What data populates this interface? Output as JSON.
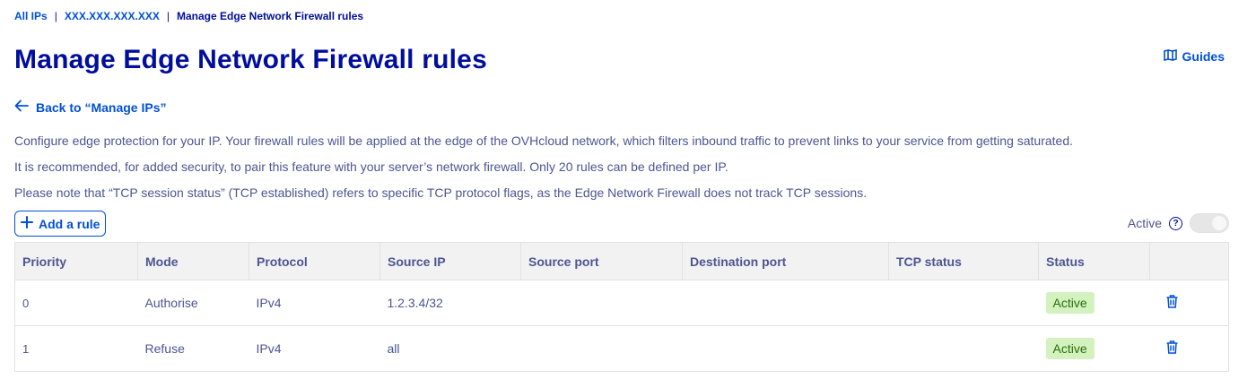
{
  "breadcrumb": {
    "root": "All IPs",
    "ip": "XXX.XXX.XXX.XXX",
    "current": "Manage Edge Network Firewall rules"
  },
  "header": {
    "title": "Manage Edge Network Firewall rules",
    "guides_label": "Guides"
  },
  "back_link": "Back to “Manage IPs”",
  "description": {
    "line1": "Configure edge protection for your IP. Your firewall rules will be applied at the edge of the OVHcloud network, which filters inbound traffic to prevent links to your service from getting saturated.",
    "line2": "It is recommended, for added security, to pair this feature with your server’s network firewall. Only 20 rules can be defined per IP.",
    "line3": "Please note that “TCP session status” (TCP established) refers to specific TCP protocol flags, as the Edge Network Firewall does not track TCP sessions."
  },
  "toolbar": {
    "add_rule_label": "Add a rule",
    "active_label": "Active",
    "help_glyph": "?"
  },
  "table": {
    "columns": [
      "Priority",
      "Mode",
      "Protocol",
      "Source IP",
      "Source port",
      "Destination port",
      "TCP status",
      "Status",
      ""
    ],
    "rows": [
      {
        "priority": "0",
        "mode": "Authorise",
        "protocol": "IPv4",
        "source_ip": "1.2.3.4/32",
        "source_port": "",
        "destination_port": "",
        "tcp_status": "",
        "status": "Active"
      },
      {
        "priority": "1",
        "mode": "Refuse",
        "protocol": "IPv4",
        "source_ip": "all",
        "source_port": "",
        "destination_port": "",
        "tcp_status": "",
        "status": "Active"
      }
    ]
  },
  "icons": {
    "guides": "book-icon",
    "back": "arrow-left-icon",
    "add": "plus-icon",
    "help": "question-circle-icon",
    "delete": "trash-icon"
  },
  "colors": {
    "primary": "#0050d7",
    "title": "#000e9c",
    "text": "#4d5592",
    "badge_bg": "#d4f1c0",
    "badge_text": "#27700a"
  }
}
